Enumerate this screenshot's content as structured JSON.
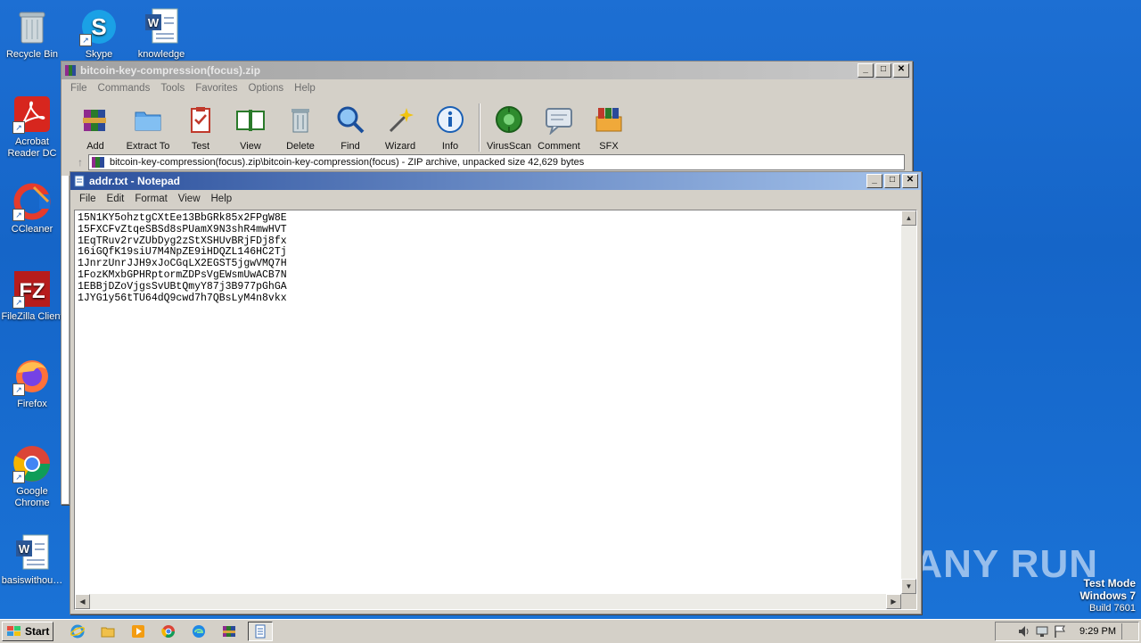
{
  "desktop": {
    "icons": [
      {
        "label": "Recycle Bin",
        "icon": "recycle-bin-icon"
      },
      {
        "label": "Skype",
        "icon": "skype-icon"
      },
      {
        "label": "knowledge",
        "icon": "word-doc-icon"
      },
      {
        "label": "Acrobat Reader DC",
        "icon": "acrobat-icon"
      },
      {
        "label": "CCleaner",
        "icon": "ccleaner-icon"
      },
      {
        "label": "FileZilla Client",
        "icon": "filezilla-icon"
      },
      {
        "label": "Firefox",
        "icon": "firefox-icon"
      },
      {
        "label": "Google Chrome",
        "icon": "chrome-icon"
      },
      {
        "label": "basiswithou…",
        "icon": "word-doc-icon"
      }
    ],
    "watermark": "ANY RUN",
    "test_mode": {
      "line1": "Test Mode",
      "line2": "Windows 7",
      "line3": "Build 7601"
    }
  },
  "winrar": {
    "title": "bitcoin-key-compression(focus).zip",
    "menu": [
      "File",
      "Commands",
      "Tools",
      "Favorites",
      "Options",
      "Help"
    ],
    "toolbar": [
      "Add",
      "Extract To",
      "Test",
      "View",
      "Delete",
      "Find",
      "Wizard",
      "Info",
      "VirusScan",
      "Comment",
      "SFX"
    ],
    "path": "bitcoin-key-compression(focus).zip\\bitcoin-key-compression(focus) - ZIP archive, unpacked size 42,629 bytes"
  },
  "notepad": {
    "title": "addr.txt - Notepad",
    "menu": [
      "File",
      "Edit",
      "Format",
      "View",
      "Help"
    ],
    "content": "15N1KY5ohztgCXtEe13BbGRk85x2FPgW8E\n15FXCFvZtqeSBSd8sPUamX9N3shR4mwHVT\n1EqTRuv2rvZUbDyg2zStXSHUvBRjFDj8fx\n16iGQfK19siU7M4NpZE9iHDQZL146HC2Tj\n1JnrzUnrJJH9xJoCGqLX2EGST5jgwVMQ7H\n1FozKMxbGPHRptormZDPsVgEWsmUwACB7N\n1EBBjDZoVjgsSvUBtQmyY87j3B977pGhGA\n1JYG1y56tTU64dQ9cwd7h7QBsLyM4n8vkx"
  },
  "taskbar": {
    "start_label": "Start",
    "clock": "9:29 PM"
  }
}
